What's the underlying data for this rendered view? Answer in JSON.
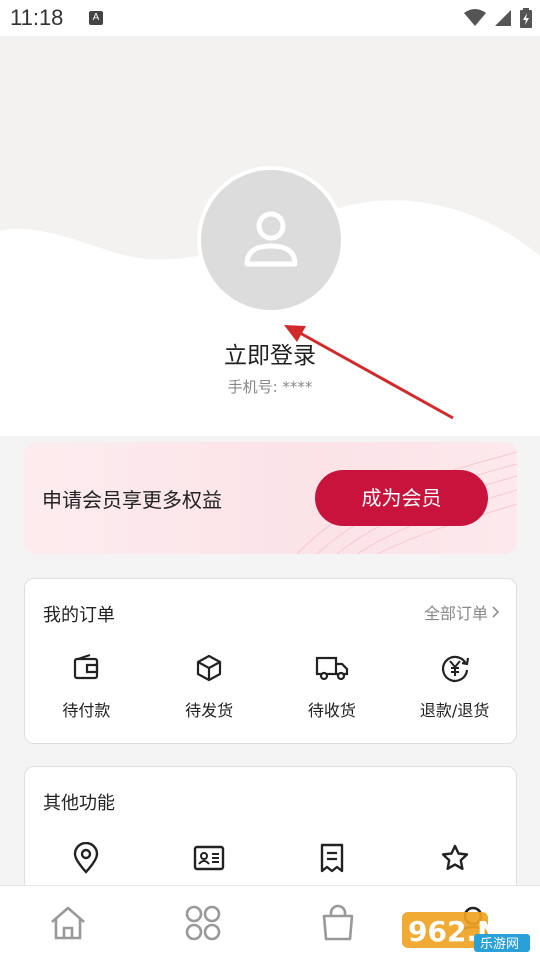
{
  "status_bar": {
    "time": "11:18",
    "notification": "A",
    "icons": [
      "wifi-icon",
      "signal-icon",
      "battery-icon"
    ]
  },
  "profile": {
    "login_label": "立即登录",
    "phone_label": "手机号: ****",
    "avatar_icon": "person-icon"
  },
  "membership": {
    "promo_text": "申请会员享更多权益",
    "join_button": "成为会员",
    "accent": "#c8143c"
  },
  "orders": {
    "title": "我的订单",
    "all_orders_link": "全部订单",
    "items": [
      {
        "label": "待付款",
        "icon": "wallet-icon"
      },
      {
        "label": "待发货",
        "icon": "package-icon"
      },
      {
        "label": "待收货",
        "icon": "truck-icon"
      },
      {
        "label": "退款/退货",
        "icon": "refund-icon"
      }
    ]
  },
  "other": {
    "title": "其他功能",
    "items": [
      {
        "icon": "location-pin-icon"
      },
      {
        "icon": "id-card-icon"
      },
      {
        "icon": "receipt-icon"
      },
      {
        "icon": "star-icon"
      }
    ]
  },
  "bottom_nav": {
    "items": [
      {
        "icon": "home-icon"
      },
      {
        "icon": "category-grid-icon"
      },
      {
        "icon": "shopping-bag-icon"
      },
      {
        "icon": "profile-icon"
      }
    ]
  },
  "watermark": {
    "brand": "962.NET",
    "subtitle": "乐游网"
  }
}
